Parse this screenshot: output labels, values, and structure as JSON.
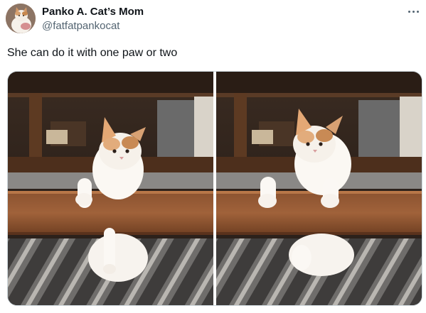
{
  "tweet": {
    "display_name": "Panko A. Cat’s Mom",
    "handle": "@fatfatpankocat",
    "text": "She can do it with one paw or two"
  },
  "icons": {
    "more": "more-horizontal-icon",
    "avatar": "cat-avatar"
  },
  "media": {
    "photos": [
      "cat-photo-one-paw",
      "cat-photo-two-paws"
    ]
  },
  "colors": {
    "text_primary": "#0f1419",
    "text_secondary": "#536471",
    "border": "#cfd9de"
  }
}
